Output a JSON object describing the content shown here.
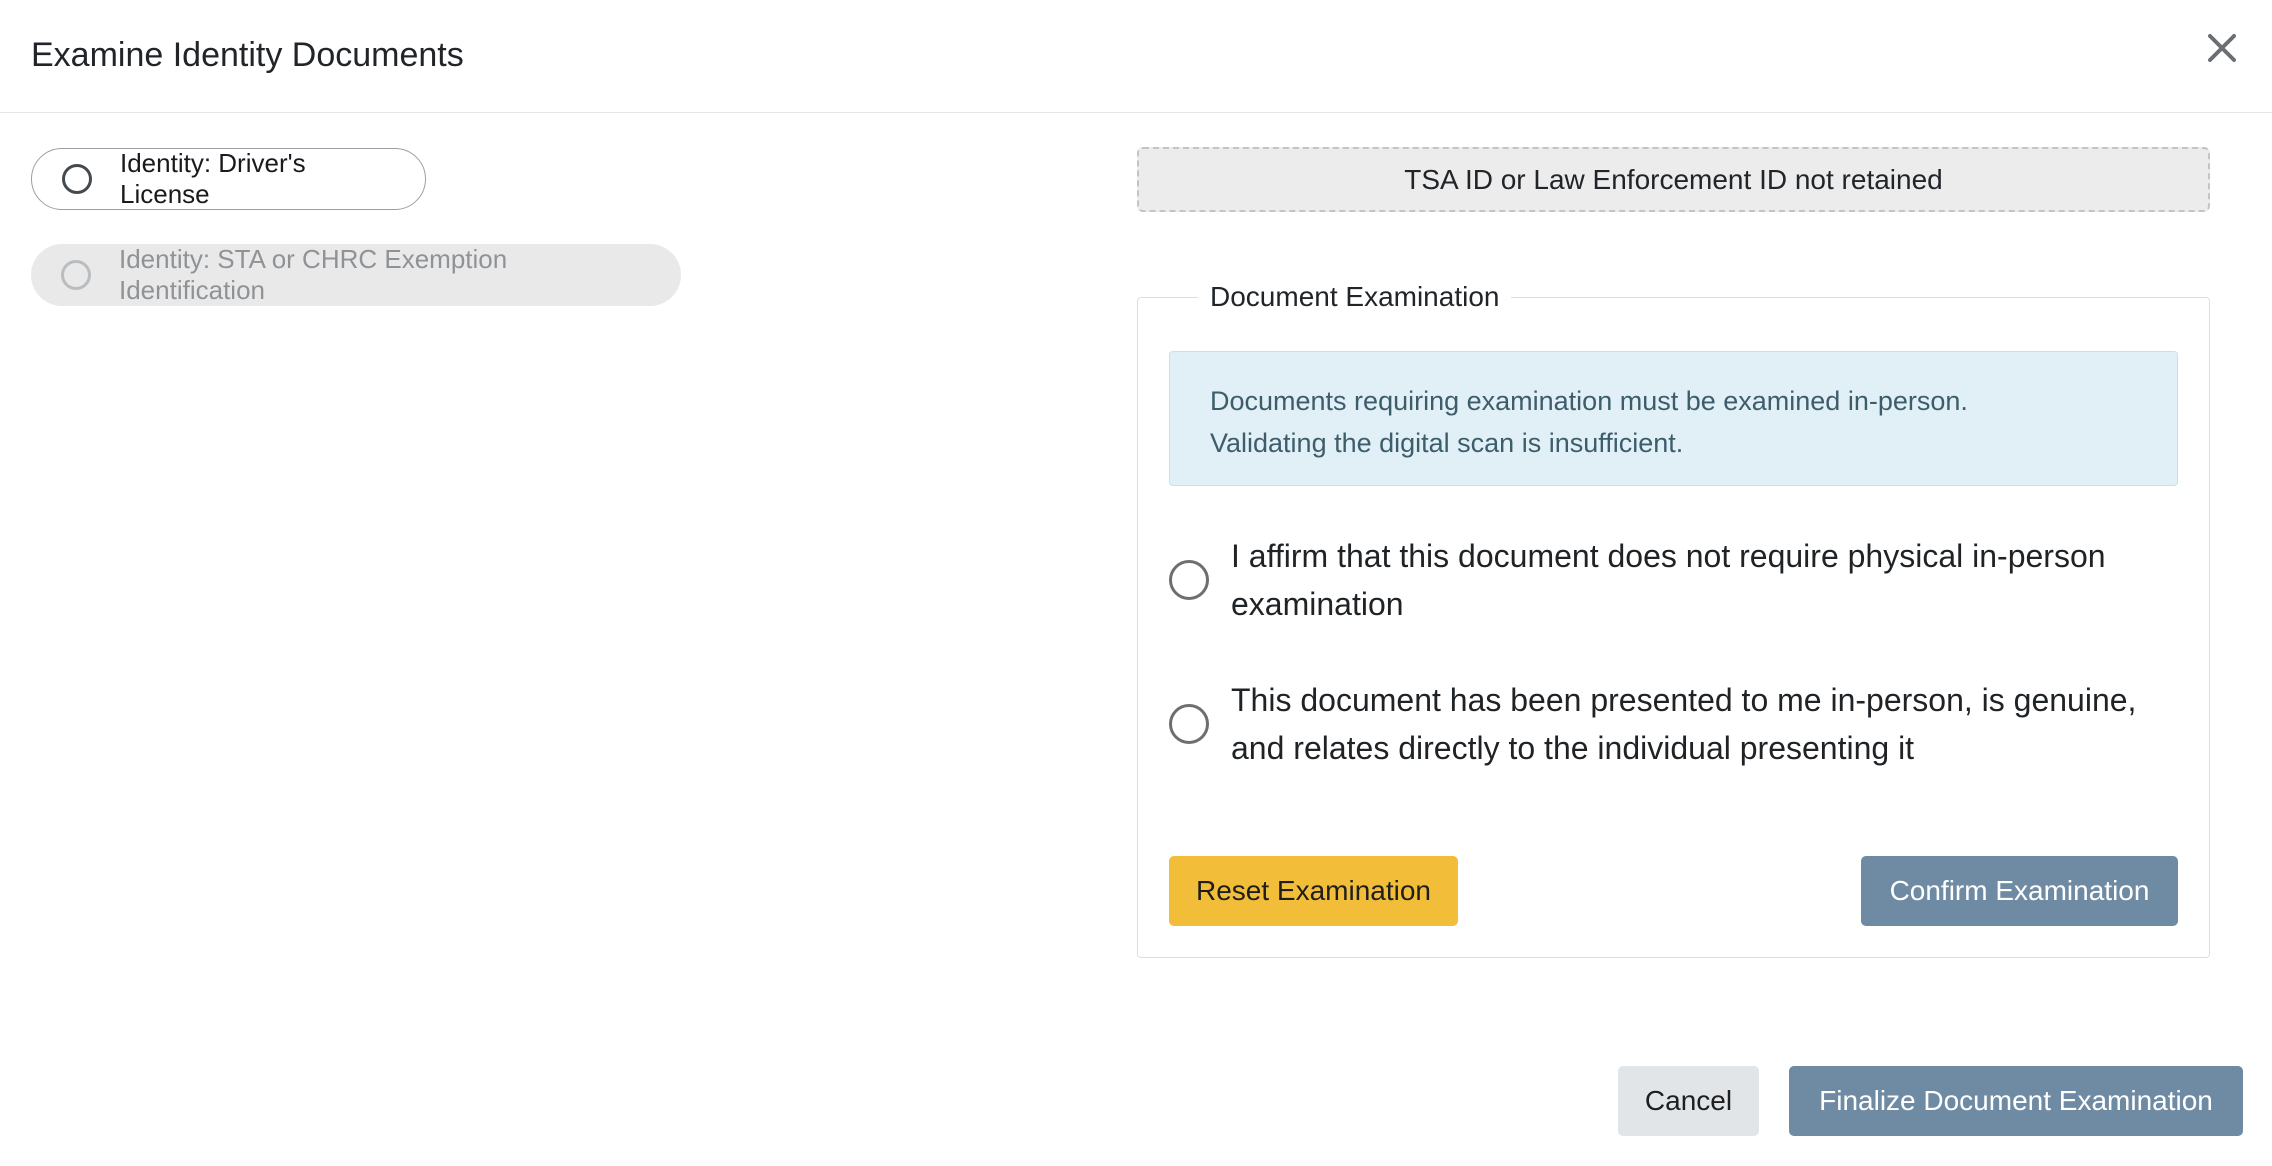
{
  "modal": {
    "title": "Examine Identity Documents",
    "close_icon": "close-icon"
  },
  "documents": [
    {
      "label": "Identity: Driver's License",
      "selected": false,
      "disabled": false
    },
    {
      "label": "Identity: STA or CHRC Exemption Identification",
      "selected": false,
      "disabled": true
    }
  ],
  "retained_notice": "TSA ID or Law Enforcement ID not retained",
  "examination": {
    "legend": "Document Examination",
    "alert_line1": "Documents requiring examination must be examined in-person.",
    "alert_line2": "Validating the digital scan is insufficient.",
    "options": [
      {
        "label": "I affirm that this document does not require physical in-person examination",
        "selected": false
      },
      {
        "label": "This document has been presented to me in-person, is genuine, and relates directly to the individual presenting it",
        "selected": false
      }
    ],
    "reset_label": "Reset Examination",
    "confirm_label": "Confirm Examination"
  },
  "footer": {
    "cancel_label": "Cancel",
    "finalize_label": "Finalize Document Examination"
  },
  "colors": {
    "reset_button": "#f2be3a",
    "primary_button": "#6f8ba4",
    "info_alert_bg": "#e0f0f6",
    "info_alert_text": "#3e5d6b"
  }
}
